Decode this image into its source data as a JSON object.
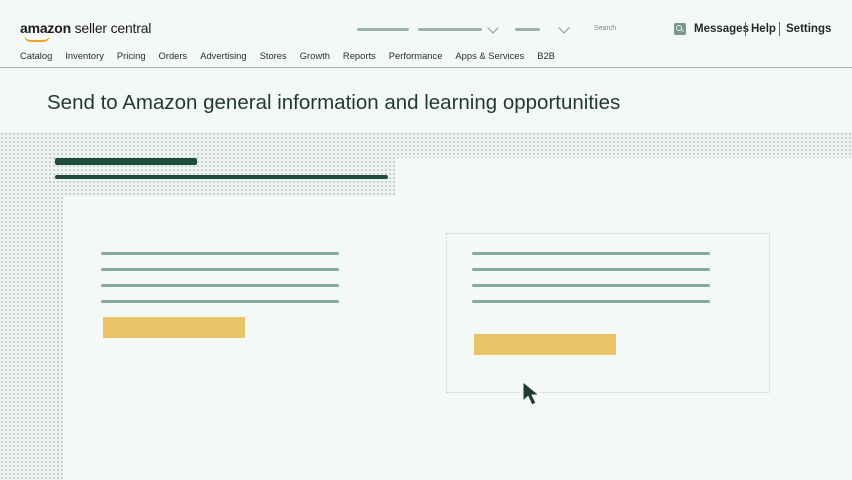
{
  "header": {
    "logo_brand": "amazon",
    "logo_rest": " seller central",
    "search_placeholder": "Search",
    "links": {
      "messages": "Messages",
      "help": "Help",
      "settings": "Settings"
    }
  },
  "nav": {
    "items": [
      "Catalog",
      "Inventory",
      "Pricing",
      "Orders",
      "Advertising",
      "Stores",
      "Growth",
      "Reports",
      "Performance",
      "Apps & Services",
      "B2B"
    ]
  },
  "page": {
    "title": "Send to Amazon general information and learning opportunities"
  },
  "colors": {
    "accent_dark": "#1e4a40",
    "placeholder_line": "#84aaa3",
    "button_yellow": "#e8c466",
    "logo_smile": "#f0a51d"
  },
  "icons": [
    "search-icon",
    "chevron-down-icon",
    "mouse-cursor-icon"
  ]
}
